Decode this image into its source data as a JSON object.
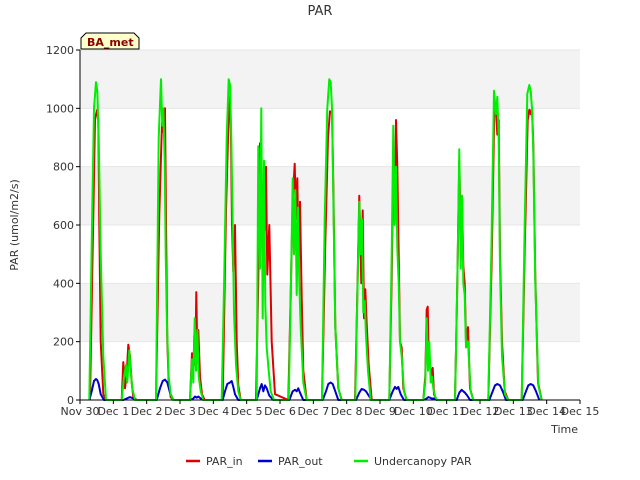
{
  "chart_data": {
    "type": "line",
    "title": "PAR",
    "xlabel": "Time",
    "ylabel": "PAR (umol/m2/s)",
    "site_label": "BA_met",
    "xlim": [
      0,
      15
    ],
    "ylim": [
      0,
      1200
    ],
    "y_ticks": [
      0,
      200,
      400,
      600,
      800,
      1000,
      1200
    ],
    "x_ticks": [
      {
        "value": 0,
        "label": "Nov 30"
      },
      {
        "value": 1,
        "label": "Dec 1"
      },
      {
        "value": 2,
        "label": "Dec 2"
      },
      {
        "value": 3,
        "label": "Dec 3"
      },
      {
        "value": 4,
        "label": "Dec 4"
      },
      {
        "value": 5,
        "label": "Dec 5"
      },
      {
        "value": 6,
        "label": "Dec 6"
      },
      {
        "value": 7,
        "label": "Dec 7"
      },
      {
        "value": 8,
        "label": "Dec 8"
      },
      {
        "value": 9,
        "label": "Dec 9"
      },
      {
        "value": 10,
        "label": "Dec 10"
      },
      {
        "value": 11,
        "label": "Dec 11"
      },
      {
        "value": 12,
        "label": "Dec 12"
      },
      {
        "value": 13,
        "label": "Dec 13"
      },
      {
        "value": 14,
        "label": "Dec 14"
      },
      {
        "value": 15,
        "label": "Dec 15"
      }
    ],
    "grid": "horizontal bands",
    "legend_position": "bottom",
    "series": [
      {
        "name": "PAR_in",
        "color": "#dd0000",
        "x": [
          0.3,
          0.38,
          0.45,
          0.5,
          0.52,
          0.55,
          0.58,
          0.62,
          0.7,
          0.78,
          1.25,
          1.3,
          1.35,
          1.4,
          1.45,
          1.5,
          1.55,
          1.6,
          1.7,
          2.28,
          2.38,
          2.46,
          2.5,
          2.53,
          2.55,
          2.58,
          2.62,
          2.66,
          2.72,
          2.8,
          3.3,
          3.36,
          3.4,
          3.43,
          3.46,
          3.49,
          3.52,
          3.55,
          3.6,
          3.66,
          3.74,
          4.28,
          4.38,
          4.46,
          4.5,
          4.53,
          4.56,
          4.6,
          4.65,
          4.7,
          4.75,
          4.82,
          5.28,
          5.35,
          5.4,
          5.45,
          5.5,
          5.54,
          5.58,
          5.62,
          5.68,
          5.75,
          5.85,
          6.25,
          6.32,
          6.38,
          6.44,
          6.48,
          6.52,
          6.56,
          6.6,
          6.65,
          6.7,
          6.8,
          7.26,
          7.36,
          7.44,
          7.5,
          7.53,
          7.56,
          7.6,
          7.66,
          7.75,
          7.85,
          8.25,
          8.32,
          8.38,
          8.44,
          8.48,
          8.52,
          8.56,
          8.6,
          8.66,
          8.75,
          9.28,
          9.35,
          9.4,
          9.45,
          9.48,
          9.52,
          9.56,
          9.6,
          9.65,
          9.7,
          9.8,
          10.3,
          10.36,
          10.4,
          10.43,
          10.46,
          10.5,
          10.54,
          10.58,
          10.62,
          10.7,
          11.25,
          11.32,
          11.38,
          11.42,
          11.46,
          11.5,
          11.54,
          11.58,
          11.64,
          11.7,
          11.8,
          12.25,
          12.35,
          12.43,
          12.48,
          12.52,
          12.56,
          12.6,
          12.66,
          12.74,
          12.85,
          13.25,
          13.35,
          13.43,
          13.48,
          13.52,
          13.56,
          13.6,
          13.66,
          13.74,
          13.85
        ],
        "y": [
          0,
          520,
          960,
          990,
          995,
          960,
          600,
          200,
          20,
          0,
          0,
          130,
          40,
          90,
          190,
          150,
          60,
          10,
          0,
          0,
          640,
          950,
          920,
          960,
          1000,
          620,
          200,
          60,
          10,
          0,
          0,
          160,
          90,
          220,
          120,
          370,
          160,
          240,
          80,
          20,
          0,
          0,
          650,
          980,
          1040,
          900,
          600,
          440,
          600,
          200,
          50,
          0,
          0,
          420,
          880,
          560,
          720,
          580,
          800,
          430,
          600,
          200,
          20,
          0,
          360,
          680,
          810,
          620,
          760,
          470,
          680,
          350,
          100,
          0,
          0,
          540,
          900,
          990,
          985,
          990,
          740,
          250,
          40,
          0,
          0,
          360,
          700,
          400,
          650,
          280,
          380,
          260,
          120,
          0,
          0,
          420,
          820,
          640,
          960,
          800,
          500,
          200,
          180,
          40,
          0,
          0,
          80,
          310,
          320,
          150,
          120,
          80,
          110,
          20,
          0,
          0,
          400,
          820,
          560,
          700,
          460,
          400,
          200,
          250,
          40,
          0,
          0,
          480,
          990,
          1000,
          910,
          960,
          500,
          200,
          30,
          0,
          0,
          560,
          960,
          995,
          980,
          1000,
          880,
          420,
          60,
          0
        ]
      },
      {
        "name": "PAR_out",
        "color": "#0000cc",
        "x": [
          0.28,
          0.35,
          0.42,
          0.48,
          0.52,
          0.56,
          0.62,
          0.72,
          1.3,
          1.4,
          1.5,
          1.6,
          1.7,
          2.3,
          2.4,
          2.48,
          2.55,
          2.62,
          2.7,
          2.8,
          3.3,
          3.4,
          3.45,
          3.5,
          3.55,
          3.62,
          3.7,
          4.28,
          4.35,
          4.42,
          4.5,
          4.55,
          4.6,
          4.65,
          4.75,
          5.3,
          5.4,
          5.45,
          5.5,
          5.55,
          5.6,
          5.68,
          5.8,
          6.28,
          6.38,
          6.45,
          6.5,
          6.55,
          6.6,
          6.7,
          7.28,
          7.38,
          7.45,
          7.52,
          7.58,
          7.66,
          7.75,
          8.28,
          8.38,
          8.45,
          8.52,
          8.58,
          8.66,
          8.75,
          9.28,
          9.38,
          9.45,
          9.5,
          9.55,
          9.62,
          9.72,
          10.3,
          10.4,
          10.45,
          10.5,
          10.55,
          10.62,
          10.7,
          11.3,
          11.38,
          11.45,
          11.5,
          11.55,
          11.62,
          11.7,
          12.28,
          12.38,
          12.45,
          12.52,
          12.6,
          12.68,
          12.78,
          13.28,
          13.38,
          13.45,
          13.52,
          13.6,
          13.68,
          13.78
        ],
        "y": [
          0,
          30,
          65,
          72,
          68,
          55,
          20,
          0,
          0,
          5,
          10,
          5,
          0,
          0,
          40,
          65,
          70,
          60,
          25,
          0,
          0,
          5,
          12,
          8,
          12,
          5,
          0,
          0,
          30,
          55,
          60,
          65,
          45,
          20,
          0,
          0,
          40,
          55,
          30,
          50,
          40,
          15,
          0,
          0,
          30,
          35,
          30,
          40,
          25,
          0,
          0,
          30,
          55,
          60,
          55,
          30,
          0,
          0,
          25,
          38,
          35,
          30,
          15,
          0,
          0,
          30,
          45,
          38,
          45,
          20,
          0,
          0,
          5,
          10,
          8,
          5,
          5,
          0,
          0,
          25,
          35,
          30,
          25,
          15,
          0,
          0,
          30,
          50,
          55,
          50,
          30,
          0,
          0,
          30,
          50,
          55,
          50,
          30,
          0
        ]
      },
      {
        "name": "Undercanopy PAR",
        "color": "#00ee00",
        "x": [
          0.28,
          0.36,
          0.42,
          0.48,
          0.52,
          0.56,
          0.62,
          0.7,
          0.78,
          1.25,
          1.32,
          1.38,
          1.42,
          1.48,
          1.52,
          1.57,
          1.65,
          2.28,
          2.36,
          2.43,
          2.47,
          2.5,
          2.54,
          2.57,
          2.61,
          2.66,
          2.72,
          2.8,
          3.3,
          3.36,
          3.4,
          3.44,
          3.48,
          3.52,
          3.56,
          3.62,
          3.7,
          4.25,
          4.32,
          4.4,
          4.46,
          4.5,
          4.54,
          4.58,
          4.62,
          4.68,
          4.75,
          4.82,
          5.3,
          5.35,
          5.4,
          5.44,
          5.48,
          5.52,
          5.56,
          5.6,
          5.66,
          5.72,
          5.82,
          6.26,
          6.32,
          6.38,
          6.42,
          6.46,
          6.5,
          6.54,
          6.58,
          6.62,
          6.7,
          6.8,
          7.26,
          7.34,
          7.42,
          7.48,
          7.52,
          7.56,
          7.6,
          7.66,
          7.75,
          7.85,
          8.26,
          8.32,
          8.38,
          8.42,
          8.46,
          8.5,
          8.54,
          8.58,
          8.64,
          8.72,
          9.28,
          9.35,
          9.4,
          9.44,
          9.48,
          9.52,
          9.56,
          9.6,
          9.65,
          9.72,
          9.8,
          10.3,
          10.36,
          10.4,
          10.44,
          10.48,
          10.52,
          10.56,
          10.6,
          10.66,
          10.72,
          11.25,
          11.32,
          11.38,
          11.42,
          11.46,
          11.5,
          11.54,
          11.58,
          11.64,
          11.72,
          11.8,
          12.25,
          12.34,
          12.42,
          12.48,
          12.52,
          12.56,
          12.6,
          12.66,
          12.75,
          12.85,
          13.25,
          13.34,
          13.42,
          13.48,
          13.52,
          13.56,
          13.6,
          13.66,
          13.75,
          13.85
        ],
        "y": [
          0,
          600,
          1000,
          1090,
          1060,
          900,
          500,
          150,
          0,
          0,
          80,
          120,
          60,
          170,
          100,
          40,
          0,
          0,
          900,
          1100,
          940,
          1000,
          820,
          500,
          250,
          80,
          20,
          0,
          0,
          140,
          60,
          280,
          100,
          240,
          80,
          30,
          0,
          0,
          380,
          900,
          1100,
          1080,
          900,
          600,
          300,
          120,
          30,
          0,
          0,
          870,
          450,
          1000,
          280,
          820,
          330,
          180,
          100,
          30,
          0,
          0,
          350,
          760,
          500,
          720,
          360,
          660,
          400,
          250,
          60,
          0,
          0,
          620,
          1000,
          1100,
          1090,
          1000,
          700,
          250,
          40,
          0,
          0,
          350,
          680,
          500,
          620,
          300,
          340,
          220,
          100,
          0,
          0,
          500,
          940,
          600,
          800,
          520,
          400,
          200,
          150,
          30,
          0,
          0,
          60,
          280,
          100,
          200,
          60,
          80,
          40,
          10,
          0,
          0,
          400,
          860,
          450,
          700,
          400,
          360,
          180,
          200,
          30,
          0,
          0,
          500,
          1060,
          980,
          1040,
          900,
          450,
          150,
          20,
          0,
          0,
          600,
          1050,
          1080,
          1060,
          1000,
          850,
          400,
          50,
          0
        ]
      }
    ]
  }
}
